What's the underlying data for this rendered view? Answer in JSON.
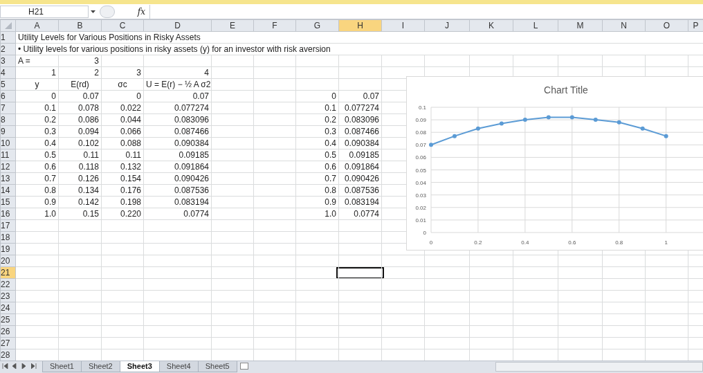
{
  "formula_bar": {
    "name_box": "H21",
    "function_label": "fx"
  },
  "columns": [
    {
      "label": "A",
      "selected": false
    },
    {
      "label": "B",
      "selected": false
    },
    {
      "label": "C",
      "selected": false
    },
    {
      "label": "D",
      "selected": false
    },
    {
      "label": "E",
      "selected": false
    },
    {
      "label": "F",
      "selected": false
    },
    {
      "label": "G",
      "selected": false
    },
    {
      "label": "H",
      "selected": true
    },
    {
      "label": "I",
      "selected": false
    },
    {
      "label": "J",
      "selected": false
    },
    {
      "label": "K",
      "selected": false
    },
    {
      "label": "L",
      "selected": false
    },
    {
      "label": "M",
      "selected": false
    },
    {
      "label": "N",
      "selected": false
    },
    {
      "label": "O",
      "selected": false
    },
    {
      "label": "P",
      "selected": false
    }
  ],
  "row_numbers": [
    {
      "label": "1",
      "selected": false
    },
    {
      "label": "2",
      "selected": false
    },
    {
      "label": "3",
      "selected": false
    },
    {
      "label": "4",
      "selected": false
    },
    {
      "label": "5",
      "selected": false
    },
    {
      "label": "6",
      "selected": false
    },
    {
      "label": "7",
      "selected": false
    },
    {
      "label": "8",
      "selected": false
    },
    {
      "label": "9",
      "selected": false
    },
    {
      "label": "10",
      "selected": false
    },
    {
      "label": "11",
      "selected": false
    },
    {
      "label": "12",
      "selected": false
    },
    {
      "label": "13",
      "selected": false
    },
    {
      "label": "14",
      "selected": false
    },
    {
      "label": "15",
      "selected": false
    },
    {
      "label": "16",
      "selected": false
    },
    {
      "label": "17",
      "selected": false
    },
    {
      "label": "18",
      "selected": false
    },
    {
      "label": "19",
      "selected": false
    },
    {
      "label": "20",
      "selected": false
    },
    {
      "label": "21",
      "selected": true
    },
    {
      "label": "22",
      "selected": false
    },
    {
      "label": "23",
      "selected": false
    },
    {
      "label": "24",
      "selected": false
    },
    {
      "label": "25",
      "selected": false
    },
    {
      "label": "26",
      "selected": false
    },
    {
      "label": "27",
      "selected": false
    },
    {
      "label": "28",
      "selected": false
    }
  ],
  "title": "Utility Levels for Various Positions in Risky Assets",
  "subtitle": "• Utility levels for various positions in risky assets (y) for an investor with risk aversion",
  "risk_aversion": {
    "label": "A =",
    "value": "3"
  },
  "table": {
    "column_numbers": [
      "1",
      "2",
      "3",
      "4"
    ],
    "headers": [
      "y",
      "E(rd)",
      "σc",
      "U = E(r) − ½ A σ2"
    ],
    "rows": [
      [
        "0",
        "0.07",
        "0",
        "0.07"
      ],
      [
        "0.1",
        "0.078",
        "0.022",
        "0.077274"
      ],
      [
        "0.2",
        "0.086",
        "0.044",
        "0.083096"
      ],
      [
        "0.3",
        "0.094",
        "0.066",
        "0.087466"
      ],
      [
        "0.4",
        "0.102",
        "0.088",
        "0.090384"
      ],
      [
        "0.5",
        "0.11",
        "0.11",
        "0.09185"
      ],
      [
        "0.6",
        "0.118",
        "0.132",
        "0.091864"
      ],
      [
        "0.7",
        "0.126",
        "0.154",
        "0.090426"
      ],
      [
        "0.8",
        "0.134",
        "0.176",
        "0.087536"
      ],
      [
        "0.9",
        "0.142",
        "0.198",
        "0.083194"
      ],
      [
        "1.0",
        "0.15",
        "0.220",
        "0.0774"
      ]
    ]
  },
  "chart_source": {
    "rows": [
      [
        "0",
        "0.07"
      ],
      [
        "0.1",
        "0.077274"
      ],
      [
        "0.2",
        "0.083096"
      ],
      [
        "0.3",
        "0.087466"
      ],
      [
        "0.4",
        "0.090384"
      ],
      [
        "0.5",
        "0.09185"
      ],
      [
        "0.6",
        "0.091864"
      ],
      [
        "0.7",
        "0.090426"
      ],
      [
        "0.8",
        "0.087536"
      ],
      [
        "0.9",
        "0.083194"
      ],
      [
        "1.0",
        "0.0774"
      ]
    ]
  },
  "chart": {
    "chart_data": {
      "type": "line",
      "title": "Chart Title",
      "x": [
        0,
        0.1,
        0.2,
        0.3,
        0.4,
        0.5,
        0.6,
        0.7,
        0.8,
        0.9,
        1.0
      ],
      "series": [
        {
          "color": "#5b9bd5",
          "marker": true,
          "values": [
            0.07,
            0.077,
            0.083,
            0.087,
            0.09,
            0.092,
            0.092,
            0.09,
            0.088,
            0.083,
            0.077
          ]
        }
      ],
      "xlim": [
        0,
        1.16
      ],
      "ylim": [
        0,
        0.1
      ],
      "grid": true,
      "xticks": [
        {
          "value": 0,
          "label": "0"
        },
        {
          "value": 0.2,
          "label": "0.2"
        },
        {
          "value": 0.4,
          "label": "0.4"
        },
        {
          "value": 0.6,
          "label": "0.6"
        },
        {
          "value": 0.8,
          "label": "0.8"
        },
        {
          "value": 1,
          "label": "1"
        }
      ],
      "yticks": [
        {
          "value": 0,
          "label": "0"
        },
        {
          "value": 0.01,
          "label": "0.01"
        },
        {
          "value": 0.02,
          "label": "0.02"
        },
        {
          "value": 0.03,
          "label": "0.03"
        },
        {
          "value": 0.04,
          "label": "0.04"
        },
        {
          "value": 0.05,
          "label": "0.05"
        },
        {
          "value": 0.06,
          "label": "0.06"
        },
        {
          "value": 0.07,
          "label": "0.07"
        },
        {
          "value": 0.08,
          "label": "0.08"
        },
        {
          "value": 0.09,
          "label": "0.09"
        },
        {
          "value": 0.1,
          "label": "0.1"
        }
      ]
    }
  },
  "sheet_tabs": [
    {
      "label": "Sheet1",
      "selected": false
    },
    {
      "label": "Sheet2",
      "selected": false
    },
    {
      "label": "Sheet3",
      "selected": true
    },
    {
      "label": "Sheet4",
      "selected": false
    },
    {
      "label": "Sheet5",
      "selected": false
    }
  ]
}
